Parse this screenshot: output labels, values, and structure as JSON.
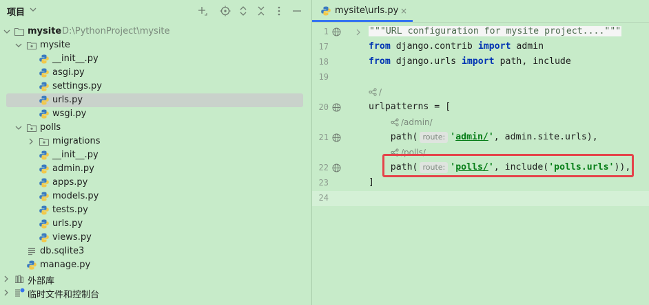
{
  "project_panel": {
    "title": "项目"
  },
  "tree": [
    {
      "label": "mysite",
      "path": "D:\\PythonProject\\mysite",
      "type": "root-folder",
      "expanded": true,
      "bold": true
    },
    {
      "label": "mysite",
      "type": "package",
      "expanded": true
    },
    {
      "label": "__init__.py",
      "type": "python-file"
    },
    {
      "label": "asgi.py",
      "type": "python-file"
    },
    {
      "label": "settings.py",
      "type": "python-file"
    },
    {
      "label": "urls.py",
      "type": "python-file",
      "selected": true
    },
    {
      "label": "wsgi.py",
      "type": "python-file"
    },
    {
      "label": "polls",
      "type": "package",
      "expanded": true
    },
    {
      "label": "migrations",
      "type": "package",
      "expanded": false
    },
    {
      "label": "__init__.py",
      "type": "python-file"
    },
    {
      "label": "admin.py",
      "type": "python-file"
    },
    {
      "label": "apps.py",
      "type": "python-file"
    },
    {
      "label": "models.py",
      "type": "python-file"
    },
    {
      "label": "tests.py",
      "type": "python-file"
    },
    {
      "label": "urls.py",
      "type": "python-file"
    },
    {
      "label": "views.py",
      "type": "python-file"
    },
    {
      "label": "db.sqlite3",
      "type": "db-file"
    },
    {
      "label": "manage.py",
      "type": "python-file"
    },
    {
      "label": "外部库",
      "type": "library",
      "expanded": false
    },
    {
      "label": "临时文件和控制台",
      "type": "scratches",
      "expanded": false
    }
  ],
  "editor": {
    "tab_label": "mysite\\urls.py",
    "tab_close": "×",
    "line_numbers": [
      "1",
      "17",
      "18",
      "19",
      "20",
      "21",
      "22",
      "23",
      "24"
    ],
    "lines": {
      "l1": "\"\"\"URL configuration for mysite project....\"\"\"",
      "l17_kw1": "from",
      "l17_mod": " django.contrib ",
      "l17_kw2": "import",
      "l17_rest": " admin",
      "l18_kw1": "from",
      "l18_mod": " django.urls ",
      "l18_kw2": "import",
      "l18_rest": " path, include",
      "l20": "urlpatterns = [",
      "l21_a": "    path(",
      "l21_hint": "route:",
      "l21_q1": "'",
      "l21_str": "admin/",
      "l21_q2": "'",
      "l21_rest": ", admin.site.urls),",
      "l22_a": "    path(",
      "l22_hint": "route:",
      "l22_q1": "'",
      "l22_str": "polls/",
      "l22_q2": "'",
      "l22_mid": ", include(",
      "l22_str2": "'polls.urls'",
      "l22_rest": ")),",
      "l23": "]"
    },
    "lens": {
      "root": "/",
      "admin": "/admin/",
      "polls": "/polls/"
    }
  }
}
